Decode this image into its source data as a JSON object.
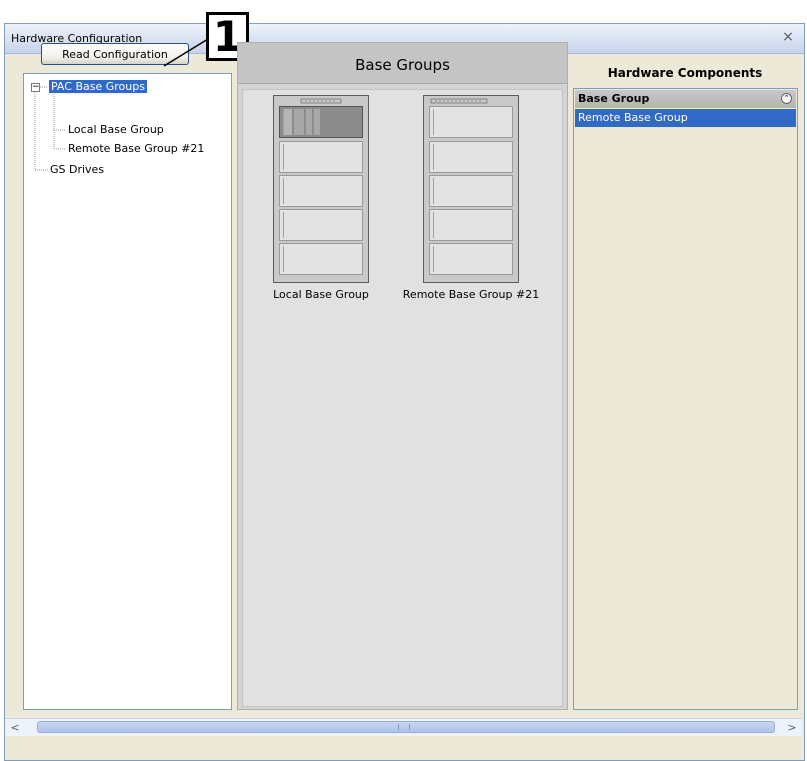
{
  "window": {
    "title": "Hardware Configuration",
    "close_glyph": "×"
  },
  "toolbar": {
    "read_label": "Read Configuration"
  },
  "callout": {
    "number": "1"
  },
  "tree": {
    "root": "PAC Base Groups",
    "expander": "−",
    "children": [
      "Local Base Group",
      "Remote Base Group #21"
    ],
    "sibling": "GS Drives"
  },
  "center": {
    "title": "Base Groups",
    "racks": [
      {
        "label": "Local Base Group",
        "slots": 5,
        "filled_slots": 1
      },
      {
        "label": "Remote Base Group #21",
        "slots": 5,
        "filled_slots": 0
      }
    ]
  },
  "right": {
    "title": "Hardware Components",
    "section": "Base Group",
    "collapse_glyph": "⌃",
    "items": [
      "Remote Base Group"
    ]
  },
  "scrollbar": {
    "left_glyph": "<",
    "right_glyph": ">"
  },
  "colors": {
    "selection": "#316ac5",
    "panel_bg": "#ece9d8",
    "border": "#7f9db9"
  }
}
